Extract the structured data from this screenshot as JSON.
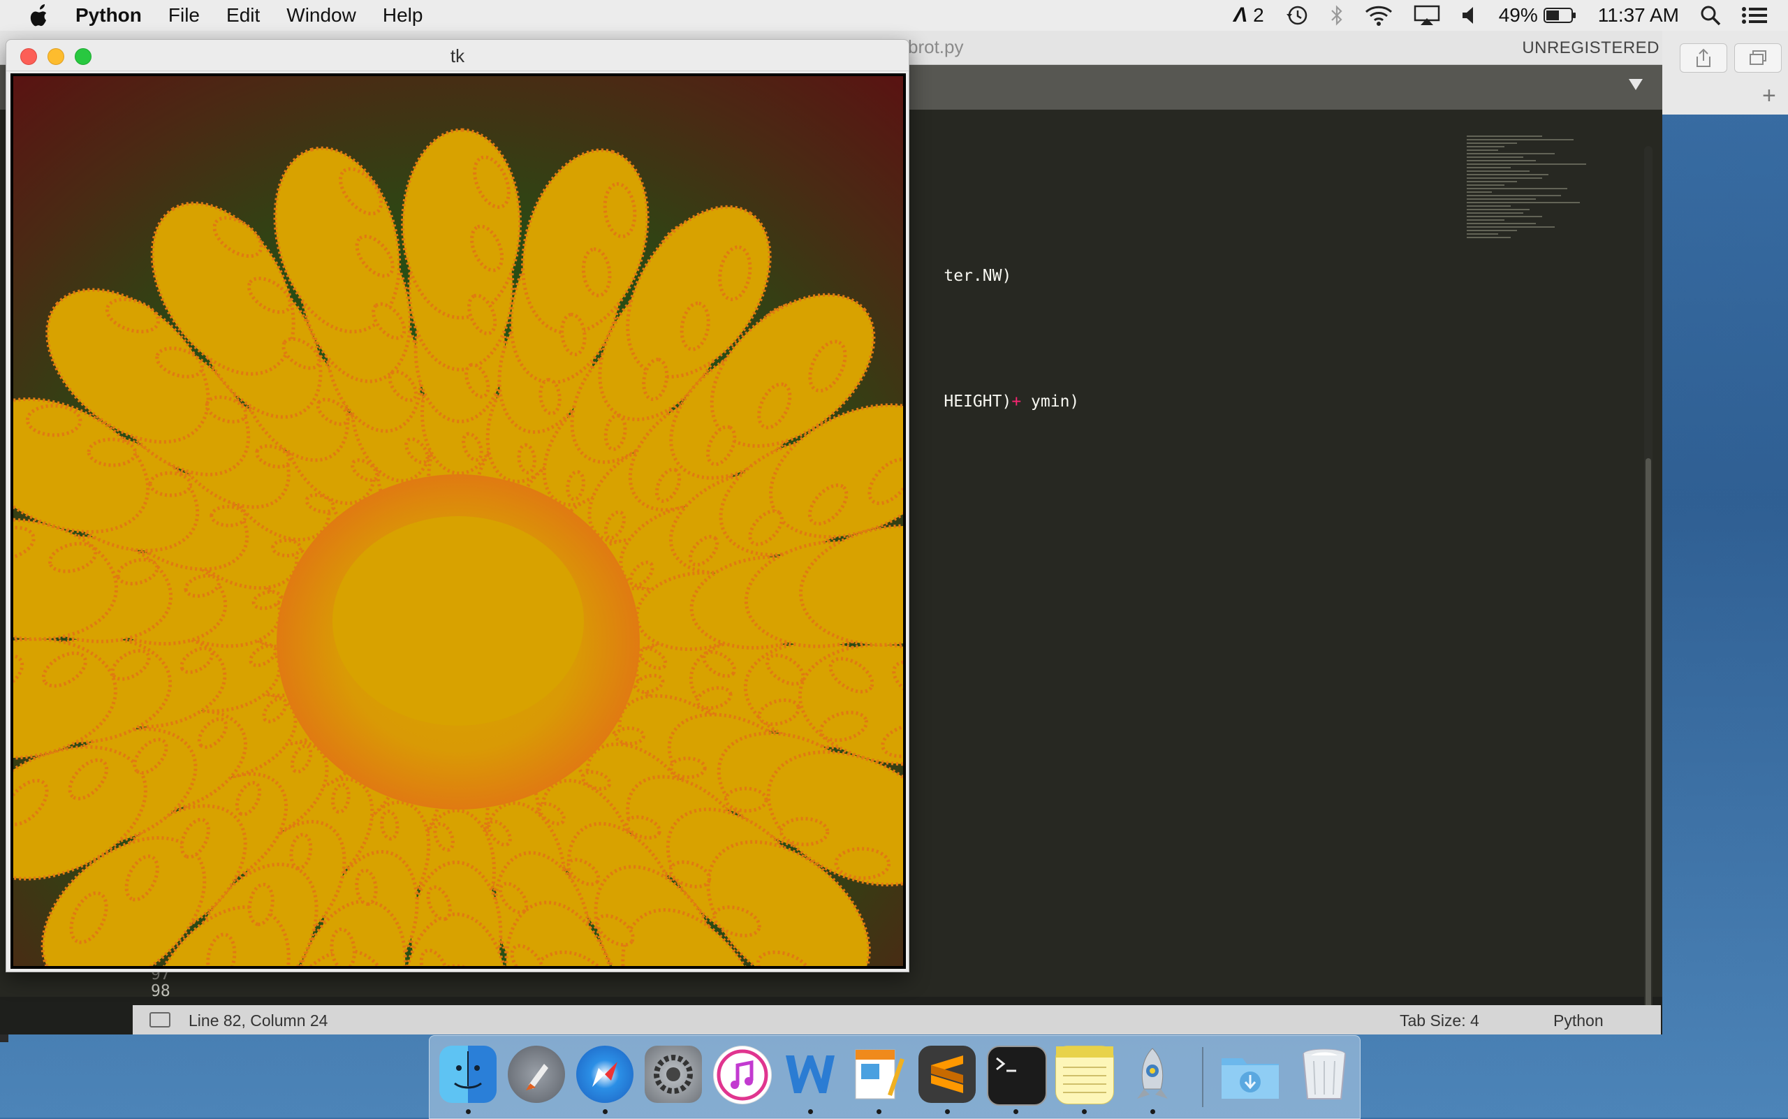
{
  "menubar": {
    "app_name": "Python",
    "menus": [
      "File",
      "Edit",
      "Window",
      "Help"
    ],
    "adobe_count": "2",
    "battery_percent": "49%",
    "clock": "11:37 AM"
  },
  "sublime": {
    "file_name": "brot.py",
    "unregistered": "UNREGISTERED",
    "code_line_1": "ter.NW)",
    "code_line_2_pre": "HEIGHT)",
    "code_line_2_op": "+",
    "code_line_2_post": " ymin)",
    "gutter_line_97": "97",
    "gutter_line_98": "98",
    "status_position": "Line 82, Column 24",
    "status_tab_size": "Tab Size: 4",
    "status_syntax": "Python"
  },
  "tk_window": {
    "title": "tk"
  },
  "colors": {
    "fractal_gold": "#d8a200",
    "fractal_orange": "#e07a12",
    "fractal_green": "#1f6b12",
    "fractal_dark_red": "#5a1212",
    "editor_bg": "#272822"
  },
  "dock": {
    "apps": [
      "finder-icon",
      "launchpad-icon",
      "safari-icon",
      "system-preferences-icon",
      "itunes-icon",
      "word-icon",
      "pages-icon",
      "sublime-text-icon",
      "terminal-icon",
      "notes-icon",
      "python-launcher-icon",
      "downloads-folder-icon",
      "trash-icon"
    ]
  }
}
